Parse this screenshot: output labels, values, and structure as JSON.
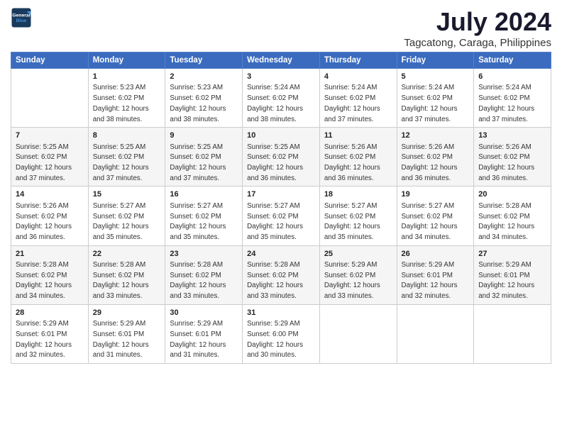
{
  "header": {
    "logo_line1": "General",
    "logo_line2": "Blue",
    "title": "July 2024",
    "subtitle": "Tagcatong, Caraga, Philippines"
  },
  "calendar": {
    "days_of_week": [
      "Sunday",
      "Monday",
      "Tuesday",
      "Wednesday",
      "Thursday",
      "Friday",
      "Saturday"
    ],
    "weeks": [
      [
        {
          "num": "",
          "info": ""
        },
        {
          "num": "1",
          "info": "Sunrise: 5:23 AM\nSunset: 6:02 PM\nDaylight: 12 hours\nand 38 minutes."
        },
        {
          "num": "2",
          "info": "Sunrise: 5:23 AM\nSunset: 6:02 PM\nDaylight: 12 hours\nand 38 minutes."
        },
        {
          "num": "3",
          "info": "Sunrise: 5:24 AM\nSunset: 6:02 PM\nDaylight: 12 hours\nand 38 minutes."
        },
        {
          "num": "4",
          "info": "Sunrise: 5:24 AM\nSunset: 6:02 PM\nDaylight: 12 hours\nand 37 minutes."
        },
        {
          "num": "5",
          "info": "Sunrise: 5:24 AM\nSunset: 6:02 PM\nDaylight: 12 hours\nand 37 minutes."
        },
        {
          "num": "6",
          "info": "Sunrise: 5:24 AM\nSunset: 6:02 PM\nDaylight: 12 hours\nand 37 minutes."
        }
      ],
      [
        {
          "num": "7",
          "info": "Sunrise: 5:25 AM\nSunset: 6:02 PM\nDaylight: 12 hours\nand 37 minutes."
        },
        {
          "num": "8",
          "info": "Sunrise: 5:25 AM\nSunset: 6:02 PM\nDaylight: 12 hours\nand 37 minutes."
        },
        {
          "num": "9",
          "info": "Sunrise: 5:25 AM\nSunset: 6:02 PM\nDaylight: 12 hours\nand 37 minutes."
        },
        {
          "num": "10",
          "info": "Sunrise: 5:25 AM\nSunset: 6:02 PM\nDaylight: 12 hours\nand 36 minutes."
        },
        {
          "num": "11",
          "info": "Sunrise: 5:26 AM\nSunset: 6:02 PM\nDaylight: 12 hours\nand 36 minutes."
        },
        {
          "num": "12",
          "info": "Sunrise: 5:26 AM\nSunset: 6:02 PM\nDaylight: 12 hours\nand 36 minutes."
        },
        {
          "num": "13",
          "info": "Sunrise: 5:26 AM\nSunset: 6:02 PM\nDaylight: 12 hours\nand 36 minutes."
        }
      ],
      [
        {
          "num": "14",
          "info": "Sunrise: 5:26 AM\nSunset: 6:02 PM\nDaylight: 12 hours\nand 36 minutes."
        },
        {
          "num": "15",
          "info": "Sunrise: 5:27 AM\nSunset: 6:02 PM\nDaylight: 12 hours\nand 35 minutes."
        },
        {
          "num": "16",
          "info": "Sunrise: 5:27 AM\nSunset: 6:02 PM\nDaylight: 12 hours\nand 35 minutes."
        },
        {
          "num": "17",
          "info": "Sunrise: 5:27 AM\nSunset: 6:02 PM\nDaylight: 12 hours\nand 35 minutes."
        },
        {
          "num": "18",
          "info": "Sunrise: 5:27 AM\nSunset: 6:02 PM\nDaylight: 12 hours\nand 35 minutes."
        },
        {
          "num": "19",
          "info": "Sunrise: 5:27 AM\nSunset: 6:02 PM\nDaylight: 12 hours\nand 34 minutes."
        },
        {
          "num": "20",
          "info": "Sunrise: 5:28 AM\nSunset: 6:02 PM\nDaylight: 12 hours\nand 34 minutes."
        }
      ],
      [
        {
          "num": "21",
          "info": "Sunrise: 5:28 AM\nSunset: 6:02 PM\nDaylight: 12 hours\nand 34 minutes."
        },
        {
          "num": "22",
          "info": "Sunrise: 5:28 AM\nSunset: 6:02 PM\nDaylight: 12 hours\nand 33 minutes."
        },
        {
          "num": "23",
          "info": "Sunrise: 5:28 AM\nSunset: 6:02 PM\nDaylight: 12 hours\nand 33 minutes."
        },
        {
          "num": "24",
          "info": "Sunrise: 5:28 AM\nSunset: 6:02 PM\nDaylight: 12 hours\nand 33 minutes."
        },
        {
          "num": "25",
          "info": "Sunrise: 5:29 AM\nSunset: 6:02 PM\nDaylight: 12 hours\nand 33 minutes."
        },
        {
          "num": "26",
          "info": "Sunrise: 5:29 AM\nSunset: 6:01 PM\nDaylight: 12 hours\nand 32 minutes."
        },
        {
          "num": "27",
          "info": "Sunrise: 5:29 AM\nSunset: 6:01 PM\nDaylight: 12 hours\nand 32 minutes."
        }
      ],
      [
        {
          "num": "28",
          "info": "Sunrise: 5:29 AM\nSunset: 6:01 PM\nDaylight: 12 hours\nand 32 minutes."
        },
        {
          "num": "29",
          "info": "Sunrise: 5:29 AM\nSunset: 6:01 PM\nDaylight: 12 hours\nand 31 minutes."
        },
        {
          "num": "30",
          "info": "Sunrise: 5:29 AM\nSunset: 6:01 PM\nDaylight: 12 hours\nand 31 minutes."
        },
        {
          "num": "31",
          "info": "Sunrise: 5:29 AM\nSunset: 6:00 PM\nDaylight: 12 hours\nand 30 minutes."
        },
        {
          "num": "",
          "info": ""
        },
        {
          "num": "",
          "info": ""
        },
        {
          "num": "",
          "info": ""
        }
      ]
    ]
  }
}
